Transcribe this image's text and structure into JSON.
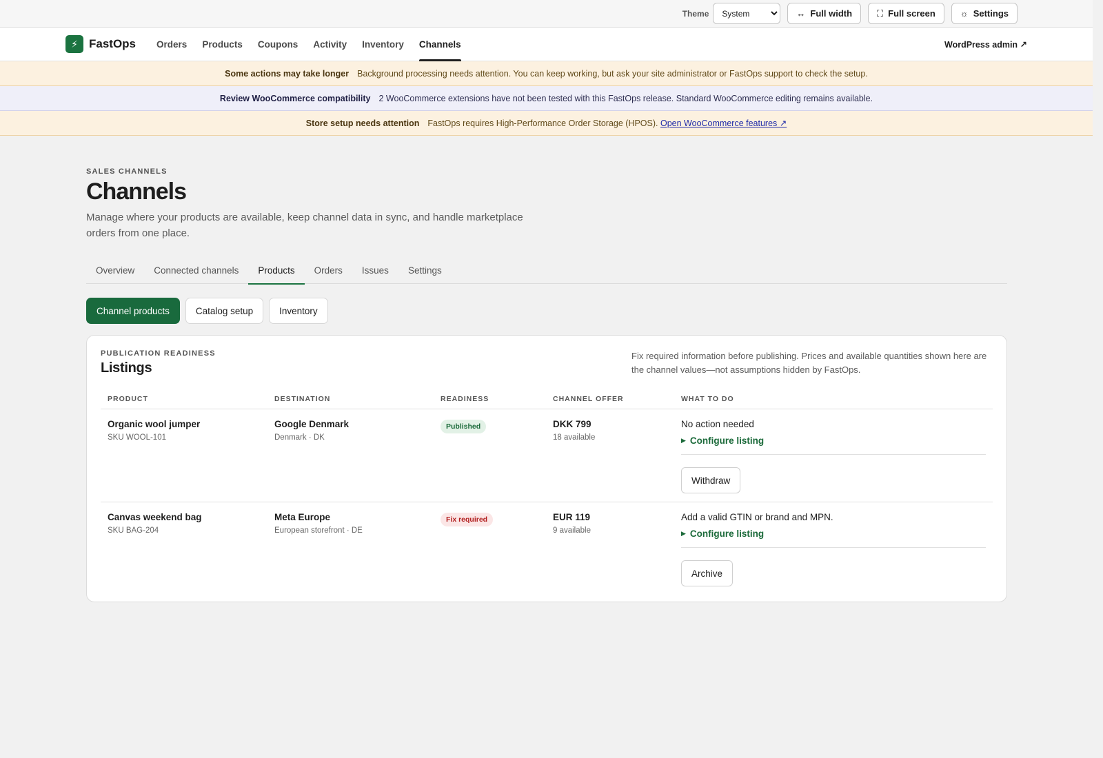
{
  "topbar": {
    "theme_label": "Theme",
    "theme_value": "System",
    "full_width": "Full width",
    "full_screen": "Full screen",
    "settings": "Settings"
  },
  "nav": {
    "brand": "FastOps",
    "items": [
      "Orders",
      "Products",
      "Coupons",
      "Activity",
      "Inventory",
      "Channels"
    ],
    "active": "Channels",
    "wp_admin": "WordPress admin ↗"
  },
  "notices": [
    {
      "title": "Some actions may take longer",
      "text": "Background processing needs attention. You can keep working, but ask your site administrator or FastOps support to check the setup.",
      "link": ""
    },
    {
      "title": "Review WooCommerce compatibility",
      "text": "2 WooCommerce extensions have not been tested with this FastOps release. Standard WooCommerce editing remains available.",
      "link": ""
    },
    {
      "title": "Store setup needs attention",
      "text": "FastOps requires High-Performance Order Storage (HPOS).",
      "link": "Open WooCommerce features ↗"
    }
  ],
  "page": {
    "eyebrow": "SALES CHANNELS",
    "title": "Channels",
    "description": "Manage where your products are available, keep channel data in sync, and handle marketplace orders from one place."
  },
  "tabs": [
    "Overview",
    "Connected channels",
    "Products",
    "Orders",
    "Issues",
    "Settings"
  ],
  "active_tab": "Products",
  "subtabs": [
    "Channel products",
    "Catalog setup",
    "Inventory"
  ],
  "active_subtab": "Channel products",
  "card": {
    "eyebrow": "PUBLICATION READINESS",
    "title": "Listings",
    "note": "Fix required information before publishing. Prices and available quantities shown here are the channel values—not assumptions hidden by FastOps."
  },
  "table": {
    "headers": [
      "PRODUCT",
      "DESTINATION",
      "READINESS",
      "CHANNEL OFFER",
      "WHAT TO DO"
    ],
    "rows": [
      {
        "product": "Organic wool jumper",
        "sku": "SKU WOOL-101",
        "destination": "Google Denmark",
        "destination_sub": "Denmark · DK",
        "readiness": "Published",
        "offer": "DKK 799",
        "available": "18 available",
        "todo": "No action needed",
        "configure": "Configure listing",
        "action": "Withdraw"
      },
      {
        "product": "Canvas weekend bag",
        "sku": "SKU BAG-204",
        "destination": "Meta Europe",
        "destination_sub": "European storefront · DE",
        "readiness": "Fix required",
        "offer": "EUR 119",
        "available": "9 available",
        "todo": "Add a valid GTIN or brand and MPN.",
        "configure": "Configure listing",
        "action": "Archive"
      }
    ]
  },
  "colors": {
    "brand_green": "#1b7340",
    "warn_bg": "#fcf1e0",
    "info_bg": "#efeff9",
    "badge_ok": "#1b6a3a",
    "badge_bad": "#b21f1f"
  }
}
